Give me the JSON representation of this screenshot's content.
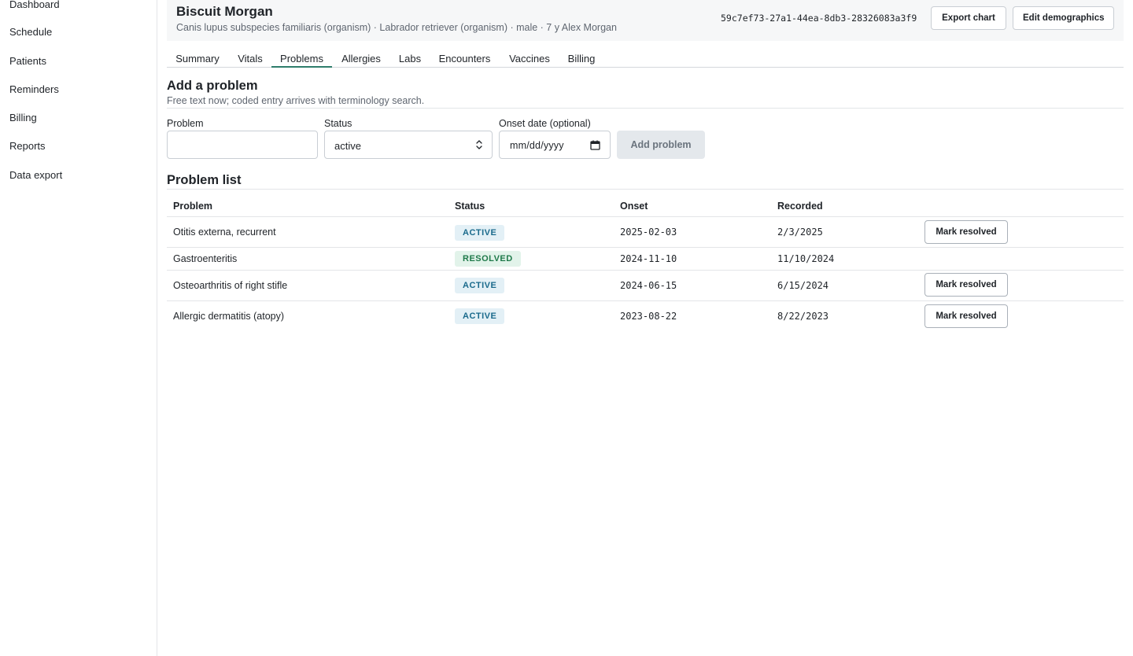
{
  "sidebar": {
    "items": [
      {
        "label": "Dashboard"
      },
      {
        "label": "Schedule"
      },
      {
        "label": "Patients"
      },
      {
        "label": "Reminders"
      },
      {
        "label": "Billing"
      },
      {
        "label": "Reports"
      },
      {
        "label": "Data export"
      }
    ]
  },
  "header": {
    "patient_name": "Biscuit Morgan",
    "patient_details": "Canis lupus subspecies familiaris (organism) · Labrador retriever (organism) · male · 7 y  Alex Morgan",
    "patient_id": "59c7ef73-27a1-44ea-8db3-28326083a3f9",
    "export_label": "Export chart",
    "edit_label": "Edit demographics"
  },
  "tabs": [
    {
      "label": "Summary",
      "active": false
    },
    {
      "label": "Vitals",
      "active": false
    },
    {
      "label": "Problems",
      "active": true
    },
    {
      "label": "Allergies",
      "active": false
    },
    {
      "label": "Labs",
      "active": false
    },
    {
      "label": "Encounters",
      "active": false
    },
    {
      "label": "Vaccines",
      "active": false
    },
    {
      "label": "Billing",
      "active": false
    }
  ],
  "add_problem": {
    "title": "Add a problem",
    "description": "Free text now; coded entry arrives with terminology search.",
    "problem_label": "Problem",
    "problem_value": "",
    "status_label": "Status",
    "status_value": "active",
    "onset_label": "Onset date (optional)",
    "onset_placeholder": "mm/dd/yyyy",
    "submit_label": "Add problem"
  },
  "problem_list": {
    "title": "Problem list",
    "columns": [
      "Problem",
      "Status",
      "Onset",
      "Recorded"
    ],
    "action_label": "Mark resolved",
    "rows": [
      {
        "problem": "Otitis externa, recurrent",
        "status": "ACTIVE",
        "onset": "2025-02-03",
        "recorded": "2/3/2025",
        "resolvable": true
      },
      {
        "problem": "Gastroenteritis",
        "status": "RESOLVED",
        "onset": "2024-11-10",
        "recorded": "11/10/2024",
        "resolvable": false
      },
      {
        "problem": "Osteoarthritis of right stifle",
        "status": "ACTIVE",
        "onset": "2024-06-15",
        "recorded": "6/15/2024",
        "resolvable": true
      },
      {
        "problem": "Allergic dermatitis (atopy)",
        "status": "ACTIVE",
        "onset": "2023-08-22",
        "recorded": "8/22/2023",
        "resolvable": true
      }
    ]
  },
  "colors": {
    "active_tab_underline": "#2e7d6b",
    "badge_active_bg": "#e3f0f6",
    "badge_active_text": "#1a6a8c",
    "badge_resolved_bg": "#e2f3ea",
    "badge_resolved_text": "#1f7a4a"
  },
  "icons": {
    "status_select": "chevron-up-down-icon",
    "onset_date": "calendar-icon"
  }
}
